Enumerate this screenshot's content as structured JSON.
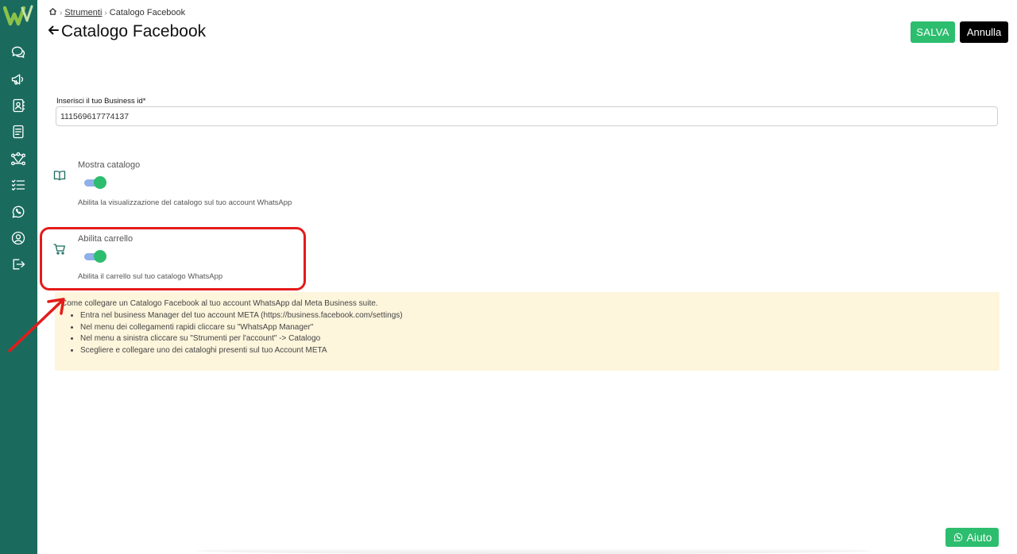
{
  "app": {
    "logo_icon": "whatsapp-business-logo",
    "accent_color": "#1a6b5e",
    "success_color": "#2dbd6e"
  },
  "sidebar": {
    "items": [
      {
        "icon": "chat-bubbles-icon"
      },
      {
        "icon": "megaphone-icon"
      },
      {
        "icon": "contacts-book-icon"
      },
      {
        "icon": "document-list-icon"
      },
      {
        "icon": "flow-graph-icon"
      },
      {
        "icon": "checklist-icon"
      },
      {
        "icon": "whatsapp-icon"
      },
      {
        "icon": "user-circle-icon"
      },
      {
        "icon": "logout-icon"
      }
    ]
  },
  "breadcrumb": {
    "home_icon": "home-icon",
    "link": "Strumenti",
    "current": "Catalogo Facebook"
  },
  "header": {
    "title": "Catalogo Facebook",
    "save_label": "SALVA",
    "cancel_label": "Annulla"
  },
  "business_field": {
    "label": "Inserisci il tuo Business id*",
    "value": "111569617774137"
  },
  "settings": [
    {
      "icon": "open-book-icon",
      "title": "Mostra catalogo",
      "enabled": true,
      "description": "Abilita la visualizzazione del catalogo sul tuo account WhatsApp"
    },
    {
      "icon": "cart-icon",
      "title": "Abilita carrello",
      "enabled": true,
      "description": "Abilita il carrello sul tuo catalogo WhatsApp"
    }
  ],
  "info": {
    "title": "Come collegare un Catalogo Facebook al tuo account WhatsApp dal Meta Business suite.",
    "steps": [
      "Entra nel business Manager del tuo account META (https://business.facebook.com/settings)",
      "Nel menu dei collegamenti rapidi cliccare su \"WhatsApp Manager\"",
      "Nel menu a sinistra cliccare su \"Strumenti per l'account\" -> Catalogo",
      "Scegliere e collegare uno dei cataloghi presenti sul tuo Account META"
    ]
  },
  "help": {
    "label": "Aiuto",
    "icon": "whatsapp-icon"
  },
  "annotation": {
    "highlight_color": "#e41b1b"
  }
}
